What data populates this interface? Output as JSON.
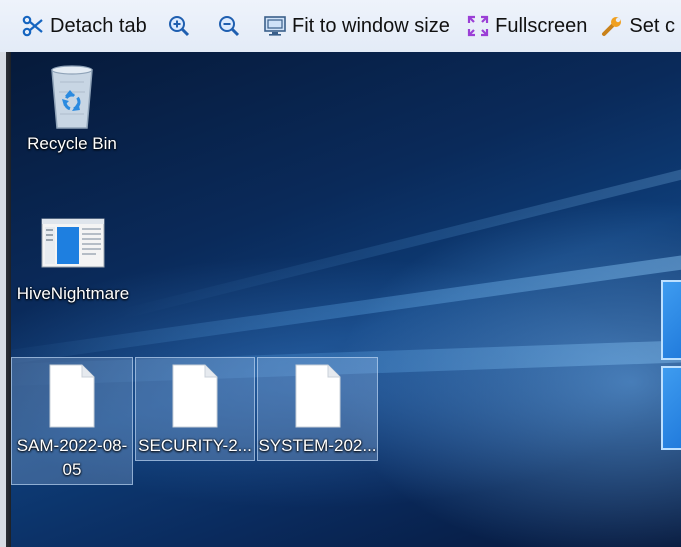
{
  "toolbar": {
    "items": [
      {
        "label": "Detach tab",
        "icon": "scissors-icon"
      },
      {
        "label": "",
        "icon": "zoom-in-icon"
      },
      {
        "label": "",
        "icon": "zoom-out-icon"
      },
      {
        "label": "Fit to window size",
        "icon": "monitor-fit-icon"
      },
      {
        "label": "Fullscreen",
        "icon": "fullscreen-icon"
      },
      {
        "label": "Set c",
        "icon": "wrench-icon"
      }
    ]
  },
  "desktop": {
    "icons": [
      {
        "label": "Recycle Bin",
        "icon": "recycle-bin-icon",
        "selected": false
      },
      {
        "label": "HiveNightmare",
        "icon": "application-window-icon",
        "selected": false
      },
      {
        "label": "SAM-2022-08-05",
        "label_lines": [
          "SAM-2022-08-",
          "05"
        ],
        "icon": "file-icon",
        "selected": true
      },
      {
        "label": "SECURITY-2...",
        "icon": "file-icon",
        "selected": true
      },
      {
        "label": "SYSTEM-202...",
        "icon": "file-icon",
        "selected": true
      }
    ]
  },
  "colors": {
    "toolbar_bg": "#e6edf8",
    "selection": "#aac8f0",
    "accent_purple": "#9b3fd6",
    "wrench_orange": "#f0a020"
  }
}
